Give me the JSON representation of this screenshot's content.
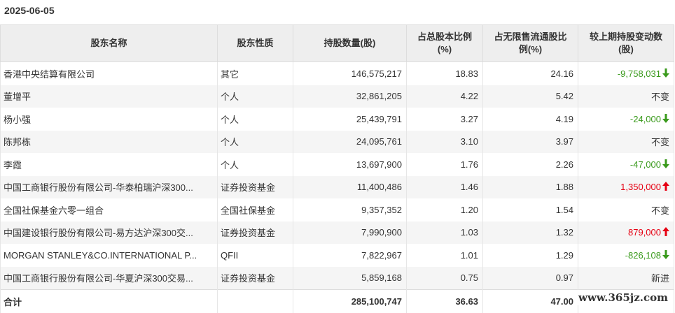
{
  "report_date": "2025-06-05",
  "columns": {
    "name": "股东名称",
    "type": "股东性质",
    "shares": "持股数量(股)",
    "pct_total_l1": "占总股本比例",
    "pct_total_l2": "(%)",
    "pct_float_l1": "占无限售流通股比",
    "pct_float_l2": "例(%)",
    "change_l1": "较上期持股变动数",
    "change_l2": "(股)"
  },
  "rows": [
    {
      "name": "香港中央结算有限公司",
      "type": "其它",
      "shares": "146,575,217",
      "pct_total": "18.83",
      "pct_float": "24.16",
      "change": "-9,758,031",
      "direction": "down"
    },
    {
      "name": "董增平",
      "type": "个人",
      "shares": "32,861,205",
      "pct_total": "4.22",
      "pct_float": "5.42",
      "change": "不变",
      "direction": "none"
    },
    {
      "name": "杨小强",
      "type": "个人",
      "shares": "25,439,791",
      "pct_total": "3.27",
      "pct_float": "4.19",
      "change": "-24,000",
      "direction": "down"
    },
    {
      "name": "陈邦栋",
      "type": "个人",
      "shares": "24,095,761",
      "pct_total": "3.10",
      "pct_float": "3.97",
      "change": "不变",
      "direction": "none"
    },
    {
      "name": "李霞",
      "type": "个人",
      "shares": "13,697,900",
      "pct_total": "1.76",
      "pct_float": "2.26",
      "change": "-47,000",
      "direction": "down"
    },
    {
      "name": "中国工商银行股份有限公司-华泰柏瑞沪深300...",
      "type": "证券投资基金",
      "shares": "11,400,486",
      "pct_total": "1.46",
      "pct_float": "1.88",
      "change": "1,350,000",
      "direction": "up"
    },
    {
      "name": "全国社保基金六零一组合",
      "type": "全国社保基金",
      "shares": "9,357,352",
      "pct_total": "1.20",
      "pct_float": "1.54",
      "change": "不变",
      "direction": "none"
    },
    {
      "name": "中国建设银行股份有限公司-易方达沪深300交...",
      "type": "证券投资基金",
      "shares": "7,990,900",
      "pct_total": "1.03",
      "pct_float": "1.32",
      "change": "879,000",
      "direction": "up"
    },
    {
      "name": "MORGAN STANLEY&CO.INTERNATIONAL P...",
      "type": "QFII",
      "shares": "7,822,967",
      "pct_total": "1.01",
      "pct_float": "1.29",
      "change": "-826,108",
      "direction": "down"
    },
    {
      "name": "中国工商银行股份有限公司-华夏沪深300交易...",
      "type": "证券投资基金",
      "shares": "5,859,168",
      "pct_total": "0.75",
      "pct_float": "0.97",
      "change": "新进",
      "direction": "none"
    }
  ],
  "total": {
    "label": "合计",
    "shares": "285,100,747",
    "pct_total": "36.63",
    "pct_float": "47.00"
  },
  "colors": {
    "decrease": "#3a9a1c",
    "increase": "#e60012",
    "corner_marker": "#ff6a00"
  },
  "icons": {
    "down": "green-down-arrow-icon",
    "up": "red-up-arrow-icon"
  },
  "watermark": "www.365jz.com"
}
